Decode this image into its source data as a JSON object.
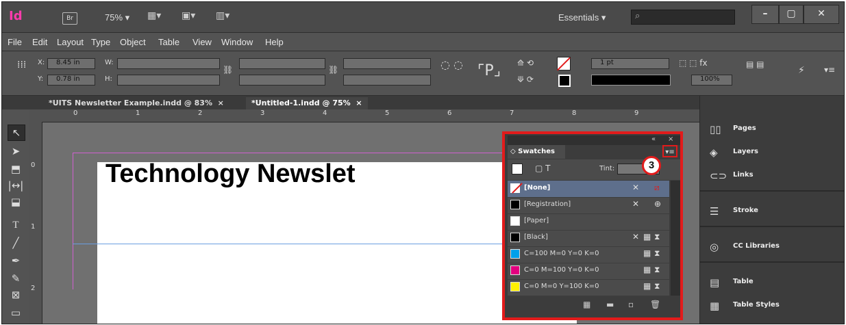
{
  "app": {
    "logo": "Id",
    "bridge": "Br",
    "zoom": "75% ▾",
    "workspace": "Essentials ▾"
  },
  "window_controls": {
    "minimize": "–",
    "maximize": "▢",
    "close": "✕"
  },
  "menu": [
    "File",
    "Edit",
    "Layout",
    "Type",
    "Object",
    "Table",
    "View",
    "Window",
    "Help"
  ],
  "control": {
    "x_label": "X:",
    "x_value": "8.45 in",
    "y_label": "Y:",
    "y_value": "0.78 in",
    "w_label": "W:",
    "h_label": "H:",
    "stroke_weight": "1 pt",
    "opacity": "100%"
  },
  "tabs": [
    {
      "label": "*UITS Newsletter Example.indd @ 83%",
      "close": "×"
    },
    {
      "label": "*Untitled-1.indd @ 75%",
      "close": "×"
    }
  ],
  "ruler": {
    "h": [
      "0",
      "1",
      "2",
      "3",
      "4",
      "5",
      "6",
      "7",
      "8",
      "9"
    ],
    "v": [
      "0",
      "1",
      "2"
    ]
  },
  "document": {
    "headline": "Technology Newslet"
  },
  "swatches": {
    "title": "◇ Swatches",
    "tint_label": "Tint:",
    "panel_arrows": "«",
    "panel_close": "×",
    "items": [
      {
        "name": "[None]",
        "color": "none"
      },
      {
        "name": "[Registration]",
        "color": "#000000"
      },
      {
        "name": "[Paper]",
        "color": "#ffffff"
      },
      {
        "name": "[Black]",
        "color": "#000000"
      },
      {
        "name": "C=100 M=0 Y=0 K=0",
        "color": "#00a0e9"
      },
      {
        "name": "C=0 M=100 Y=0 K=0",
        "color": "#e4007f"
      },
      {
        "name": "C=0 M=0 Y=100 K=0",
        "color": "#fff100"
      }
    ]
  },
  "callout": "3",
  "dock": [
    {
      "label": "Pages",
      "icon": "pages-icon"
    },
    {
      "label": "Layers",
      "icon": "layers-icon"
    },
    {
      "label": "Links",
      "icon": "links-icon"
    },
    {
      "label": "Stroke",
      "icon": "stroke-icon"
    },
    {
      "label": "CC Libraries",
      "icon": "cc-libraries-icon"
    },
    {
      "label": "Table",
      "icon": "table-icon"
    },
    {
      "label": "Table Styles",
      "icon": "table-styles-icon"
    }
  ]
}
